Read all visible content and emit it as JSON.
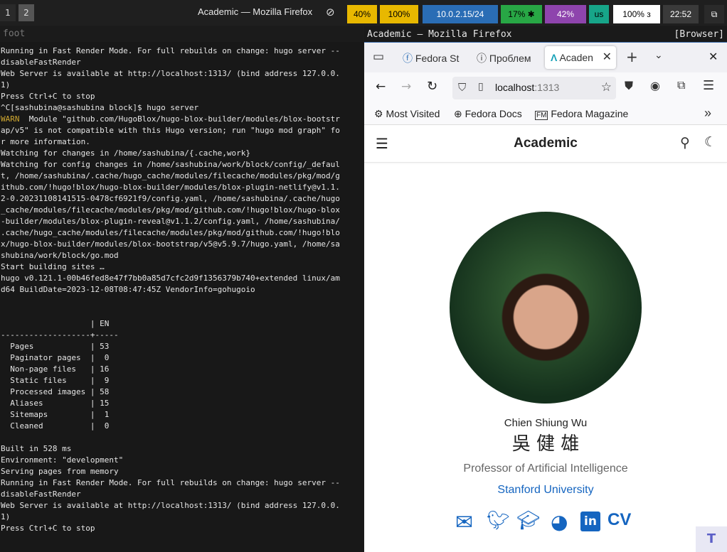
{
  "topbar": {
    "workspaces": [
      "1",
      "2"
    ],
    "window_title": "Academic — Mozilla Firefox",
    "blocks": [
      {
        "text": "40%",
        "bg": "#e8b800",
        "fg": "#000"
      },
      {
        "text": "100%",
        "bg": "#e8b800",
        "fg": "#000"
      },
      {
        "text": "10.0.2.15/24",
        "bg": "#2a6db5",
        "fg": "#fff"
      },
      {
        "text": "17%",
        "bg": "#28a745",
        "fg": "#000"
      },
      {
        "text": "42%",
        "bg": "#8e44ad",
        "fg": "#fff"
      },
      {
        "text": "us",
        "bg": "#17a589",
        "fg": "#000"
      },
      {
        "text": "100% з",
        "bg": "#ffffff",
        "fg": "#000"
      },
      {
        "text": "22:52",
        "bg": "#3a3a3a",
        "fg": "#fff"
      }
    ]
  },
  "terminal": {
    "title": "foot",
    "lines": [
      "Running in Fast Render Mode. For full rebuilds on change: hugo server --",
      "disableFastRender",
      "Web Server is available at http://localhost:1313/ (bind address 127.0.0.",
      "1)",
      "Press Ctrl+C to stop",
      "^C[sashubina@sashubina block]$ hugo server",
      "WARN  Module \"github.com/HugoBlox/hugo-blox-builder/modules/blox-bootstr",
      "ap/v5\" is not compatible with this Hugo version; run \"hugo mod graph\" fo",
      "r more information.",
      "Watching for changes in /home/sashubina/{.cache,work}",
      "Watching for config changes in /home/sashubina/work/block/config/_defaul",
      "t, /home/sashubina/.cache/hugo_cache/modules/filecache/modules/pkg/mod/g",
      "ithub.com/!hugo!blox/hugo-blox-builder/modules/blox-plugin-netlify@v1.1.",
      "2-0.20231108141515-0478cf6921f9/config.yaml, /home/sashubina/.cache/hugo",
      "_cache/modules/filecache/modules/pkg/mod/github.com/!hugo!blox/hugo-blox",
      "-builder/modules/blox-plugin-reveal@v1.1.2/config.yaml, /home/sashubina/",
      ".cache/hugo_cache/modules/filecache/modules/pkg/mod/github.com/!hugo!blo",
      "x/hugo-blox-builder/modules/blox-bootstrap/v5@v5.9.7/hugo.yaml, /home/sa",
      "shubina/work/block/go.mod",
      "Start building sites …",
      "hugo v0.121.1-00b46fed8e47f7bb0a85d7cfc2d9f1356379b740+extended linux/am",
      "d64 BuildDate=2023-12-08T08:47:45Z VendorInfo=gohugoio",
      "",
      "",
      "                   | EN",
      "-------------------+-----",
      "  Pages            | 53",
      "  Paginator pages  |  0",
      "  Non-page files   | 16",
      "  Static files     |  9",
      "  Processed images | 58",
      "  Aliases          | 15",
      "  Sitemaps         |  1",
      "  Cleaned          |  0",
      "",
      "Built in 528 ms",
      "Environment: \"development\"",
      "Serving pages from memory",
      "Running in Fast Render Mode. For full rebuilds on change: hugo server --",
      "disableFastRender",
      "Web Server is available at http://localhost:1313/ (bind address 127.0.0.",
      "1)",
      "Press Ctrl+C to stop"
    ]
  },
  "firefox": {
    "window_title": "Academic — Mozilla Firefox",
    "window_tag": "[Browser]",
    "tabs": [
      "Fedora St",
      "Проблем",
      "Acaden"
    ],
    "url_host": "localhost",
    "url_port": ":1313",
    "bookmarks": [
      "Most Visited",
      "Fedora Docs",
      "Fedora Magazine"
    ]
  },
  "site": {
    "brand": "Academic",
    "name": "Chien Shiung Wu",
    "name_cn": "吳 健 雄",
    "role": "Professor of Artificial Intelligence",
    "org": "Stanford University",
    "cv_label": "CV",
    "accent": "#1565c0"
  }
}
